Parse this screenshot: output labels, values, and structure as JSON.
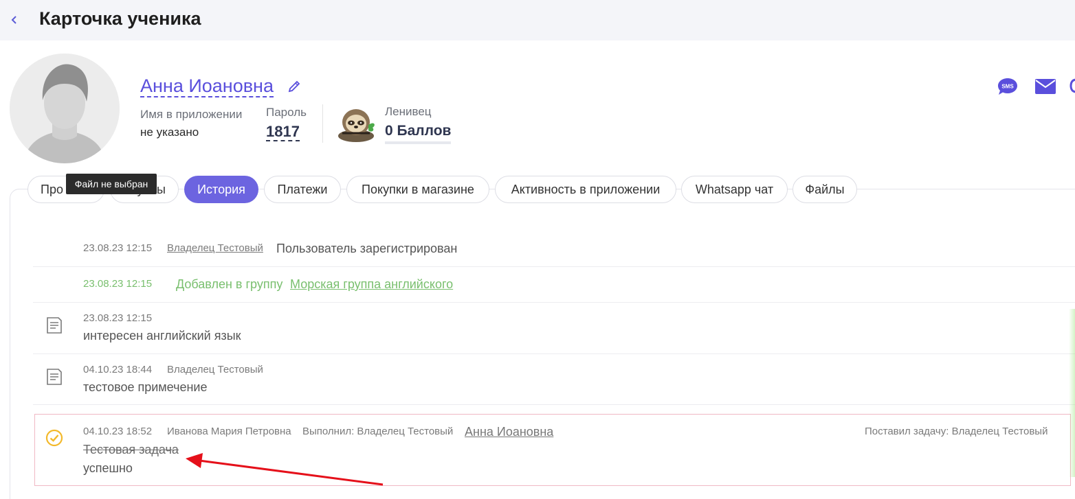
{
  "header": {
    "title": "Карточка ученика",
    "back_icon": "chevron-left-icon"
  },
  "student": {
    "name": "Анна Иоановна",
    "app_name_label": "Имя в приложении",
    "app_name_value": "не указано",
    "password_label": "Пароль",
    "password_value": "1817",
    "level_label": "Ленивец",
    "points_value": "0 Баллов"
  },
  "actions": [
    {
      "icon": "sms-icon",
      "text": "SMS"
    },
    {
      "icon": "envelope-icon"
    },
    {
      "icon": "chat-icon"
    }
  ],
  "tooltip": "Файл не выбран",
  "tabs": [
    {
      "label": "Профиль",
      "visible_fragment": "Про"
    },
    {
      "label": "Группы",
      "visible_fragment": "уппы"
    },
    {
      "label": "История",
      "active": true
    },
    {
      "label": "Платежи"
    },
    {
      "label": "Покупки в магазине"
    },
    {
      "label": "Активность в приложении"
    },
    {
      "label": "Whatsapp чат"
    },
    {
      "label": "Файлы"
    }
  ],
  "history": [
    {
      "time": "23.08.23 12:15",
      "author": "Владелец Тестовый",
      "text": "Пользователь зарегистрирован"
    },
    {
      "time": "23.08.23 12:15",
      "text_prefix": "Добавлен в группу",
      "group_link": "Морская группа английского"
    },
    {
      "time": "23.08.23 12:15",
      "text": "интересен английский язык",
      "icon": "note-icon"
    },
    {
      "time": "04.10.23 18:44",
      "author": "Владелец Тестовый",
      "text": "тестовое примечение",
      "icon": "note-icon"
    }
  ],
  "task": {
    "time": "04.10.23 18:52",
    "assignee": "Иванова Мария Петровна",
    "done_by": "Выполнил: Владелец Тестовый",
    "student_link": "Анна Иоановна",
    "set_by": "Поставил задачу: Владелец Тестовый",
    "title": "Тестовая задача",
    "result": "успешно",
    "icon": "check-circle-icon"
  },
  "colors": {
    "accent": "#6c64e0",
    "link": "#5a4fdc",
    "green": "#79bf6e",
    "task_border": "#f0b8c4",
    "arrow": "#e5101a",
    "check": "#f3b92b"
  }
}
